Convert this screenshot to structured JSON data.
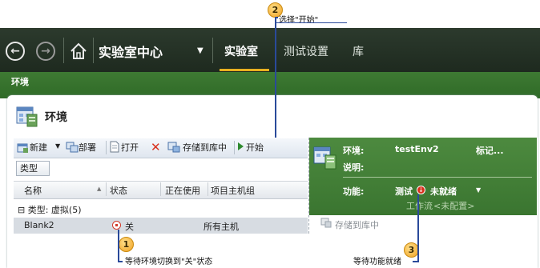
{
  "nav": {
    "title": "实验室中心",
    "tabs": [
      {
        "label": "实验室",
        "active": true
      },
      {
        "label": "测试设置",
        "active": false
      },
      {
        "label": "库",
        "active": false
      }
    ],
    "sub_tab": "环境"
  },
  "panel": {
    "title": "环境"
  },
  "toolbar": {
    "new_label": "新建",
    "deploy_label": "部署",
    "open_label": "打开",
    "store_label": "存储到库中",
    "start_label": "开始"
  },
  "list": {
    "filter_button": "类型",
    "columns": [
      "名称",
      "状态",
      "正在使用",
      "项目主机组"
    ],
    "group_label": "类型: 虚拟(5)",
    "group_toggle": "⊟",
    "rows": [
      {
        "name": "Blank2",
        "status": "关",
        "in_use": "",
        "host_group": "所有主机"
      }
    ]
  },
  "details": {
    "env_label": "环境:",
    "env_value": "testEnv2",
    "mark_label": "标记...",
    "desc_label": "说明:",
    "capability_label": "功能:",
    "capability_test": "测试",
    "capability_status": "未就绪",
    "workflow_label": "工作流",
    "workflow_value": "<未配置>",
    "store_label": "存储到库中"
  },
  "callouts": [
    {
      "number": "1",
      "text": "等待环境切换到\"关\"状态"
    },
    {
      "number": "2",
      "text": "选择\"开始\""
    },
    {
      "number": "3",
      "text": "等待功能就绪"
    }
  ],
  "colors": {
    "nav_bg": "#2c3a2d",
    "env_bar": "#3e7a33",
    "accent": "#e8b020",
    "details_bg": "#4d8a3f",
    "callout": "#f0a020"
  }
}
